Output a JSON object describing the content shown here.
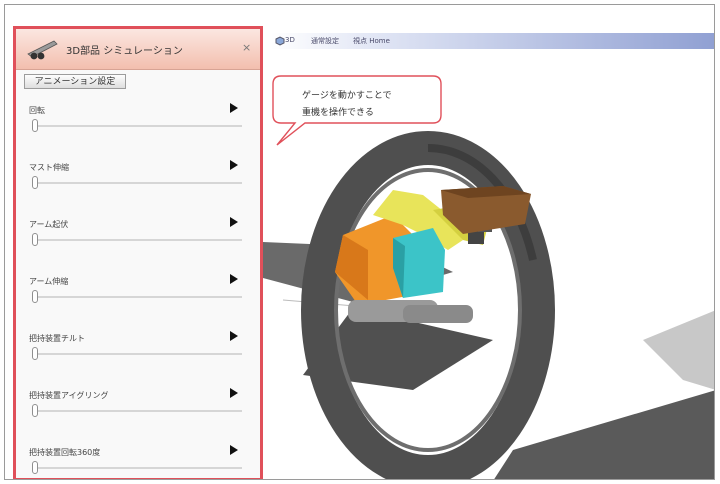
{
  "panel": {
    "title": "3D部品 シミュレーション",
    "close_glyph": "×",
    "animation_button": "アニメーション設定",
    "play_glyph": "▶",
    "controls": [
      {
        "label": "回転",
        "value": 0
      },
      {
        "label": "マスト伸縮",
        "value": 0
      },
      {
        "label": "アーム起伏",
        "value": 0
      },
      {
        "label": "アーム伸縮",
        "value": 0
      },
      {
        "label": "把持装置チルト",
        "value": 0
      },
      {
        "label": "把持装置アイグリング",
        "value": 0
      },
      {
        "label": "把持装置回転360度",
        "value": 0
      }
    ]
  },
  "viewport": {
    "tabs": [
      "3D",
      "通常設定",
      "視点 Home"
    ]
  },
  "callout": {
    "line1": "ゲージを動かすことで",
    "line2": "重機を操作できる"
  },
  "colors": {
    "panel_border": "#e0505a",
    "ring": "#555555",
    "machine_yellow": "#e8e45a",
    "machine_orange": "#f0962a",
    "machine_cyan": "#3cc4c8",
    "segment_brown": "#7a4a24"
  },
  "icons": {
    "app": "3d-parts-icon",
    "play": "play-icon",
    "close": "close-icon",
    "view": "3d-view-icon"
  }
}
